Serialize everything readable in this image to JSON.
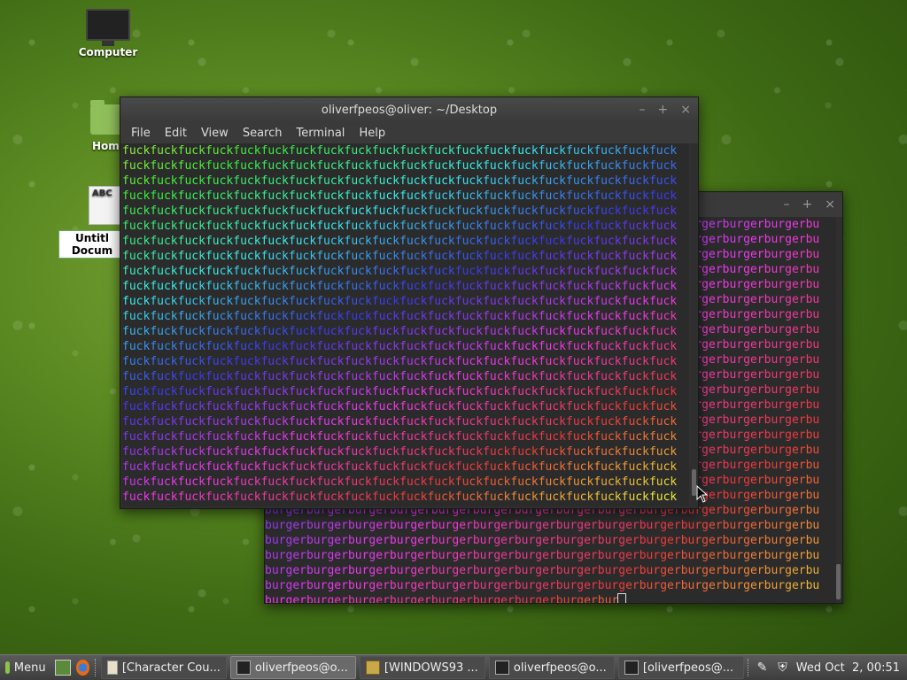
{
  "desktop": {
    "icons": [
      {
        "label": "Computer"
      },
      {
        "label": "Hom"
      },
      {
        "label": "Untitl Docum"
      }
    ]
  },
  "window_front": {
    "title": "oliverfpeos@oliver: ~/Desktop",
    "menu": [
      "File",
      "Edit",
      "View",
      "Search",
      "Terminal",
      "Help"
    ],
    "word": "fuck",
    "controls": [
      "–",
      "+",
      "×"
    ]
  },
  "window_back": {
    "word": "burger",
    "prompt_tail": "burgerburgerburgerburgerburgerburgerburgerburgerbur",
    "controls": [
      "–",
      "+",
      "×"
    ]
  },
  "taskbar": {
    "menu_label": "Menu",
    "items": [
      {
        "label": "[Character Cou...",
        "icon": "text-editor-icon"
      },
      {
        "label": "oliverfpeos@o...",
        "icon": "terminal-icon",
        "active": true
      },
      {
        "label": "[WINDOWS93 ...",
        "icon": "archive-icon"
      },
      {
        "label": "oliverfpeos@o...",
        "icon": "terminal-icon"
      },
      {
        "label": "[oliverfpeos@...",
        "icon": "terminal-icon"
      }
    ],
    "clock": "Wed Oct  2, 00:51"
  }
}
